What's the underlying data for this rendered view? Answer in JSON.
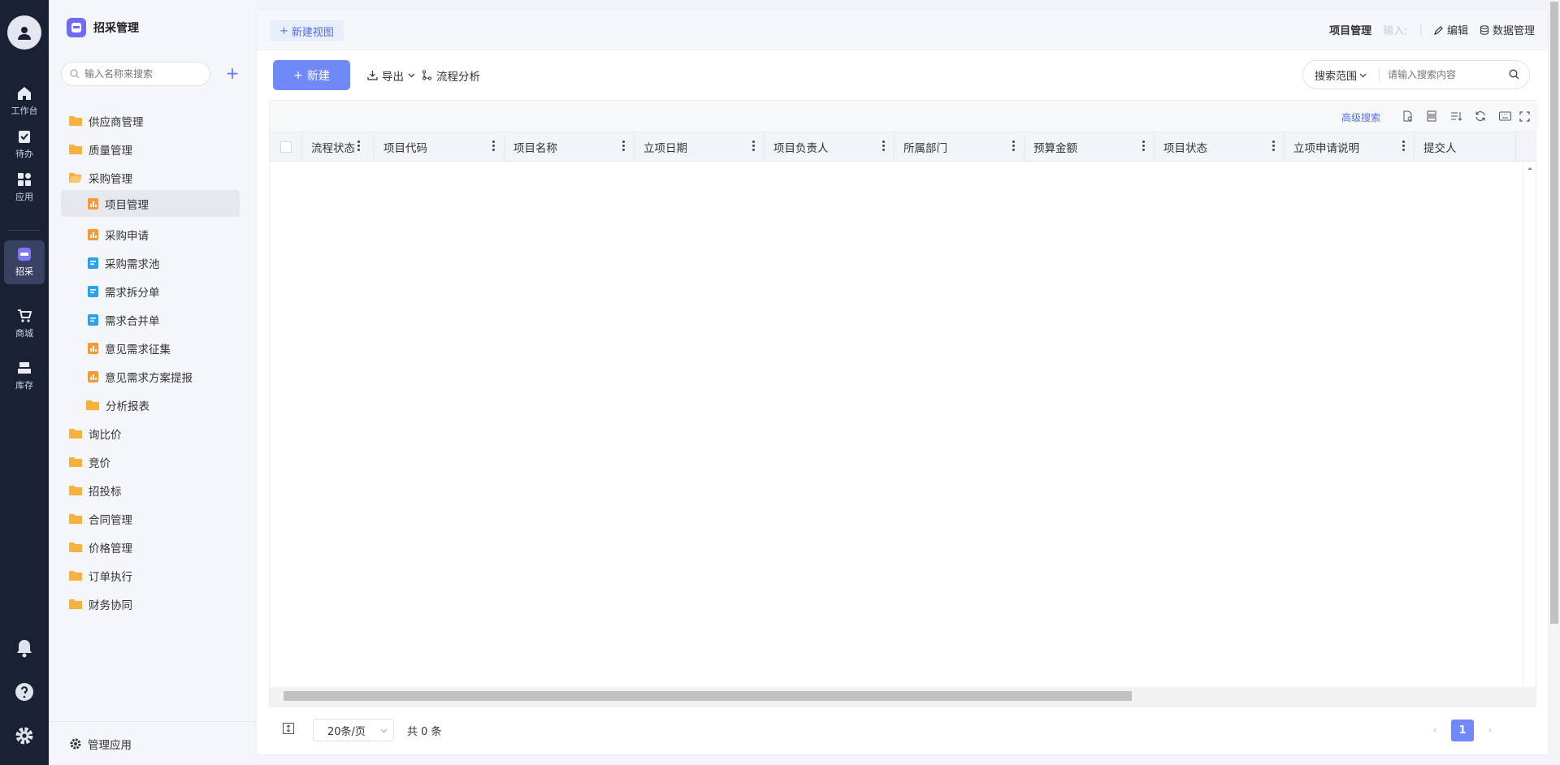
{
  "rail": {
    "items": [
      {
        "label": "工作台",
        "icon": "home-icon"
      },
      {
        "label": "待办",
        "icon": "todo-icon"
      },
      {
        "label": "应用",
        "icon": "apps-icon"
      },
      {
        "label": "招采",
        "icon": "procure-icon"
      },
      {
        "label": "商城",
        "icon": "cart-icon"
      },
      {
        "label": "库存",
        "icon": "inventory-icon"
      }
    ],
    "active": "招采"
  },
  "sidebar": {
    "app_title": "招采管理",
    "search_placeholder": "输入名称来搜索",
    "add_label": "+",
    "items": [
      {
        "label": "供应商管理",
        "type": "folder"
      },
      {
        "label": "质量管理",
        "type": "folder"
      },
      {
        "label": "采购管理",
        "type": "folder"
      },
      {
        "label": "项目管理",
        "type": "form-orange",
        "active": true
      },
      {
        "label": "采购申请",
        "type": "form-orange"
      },
      {
        "label": "采购需求池",
        "type": "form-blue"
      },
      {
        "label": "需求拆分单",
        "type": "form-blue"
      },
      {
        "label": "需求合并单",
        "type": "form-blue"
      },
      {
        "label": "意见需求征集",
        "type": "form-orange"
      },
      {
        "label": "意见需求方案提报",
        "type": "form-orange"
      },
      {
        "label": "分析报表",
        "type": "folder"
      },
      {
        "label": "询比价",
        "type": "folder"
      },
      {
        "label": "竞价",
        "type": "folder"
      },
      {
        "label": "招投标",
        "type": "folder"
      },
      {
        "label": "合同管理",
        "type": "folder"
      },
      {
        "label": "价格管理",
        "type": "folder"
      },
      {
        "label": "订单执行",
        "type": "folder"
      },
      {
        "label": "财务协同",
        "type": "folder"
      }
    ],
    "footer_label": "管理应用"
  },
  "topbar": {
    "new_view": "新建视图",
    "page_title": "项目管理",
    "input_hint": "输入:",
    "separator": "|",
    "edit": "编辑",
    "data_manage": "数据管理"
  },
  "toolbar": {
    "new_label": "新建",
    "export_label": "导出",
    "flow_label": "流程分析",
    "scope_label": "搜索范围",
    "search_placeholder": "请输入搜索内容"
  },
  "grid": {
    "advanced_search": "高级搜索",
    "columns": [
      "流程状态",
      "项目代码",
      "项目名称",
      "立项日期",
      "项目负责人",
      "所属部门",
      "预算金额",
      "项目状态",
      "立项申请说明",
      "提交人"
    ],
    "rows": []
  },
  "pager": {
    "page_size": "20条/页",
    "total": "共 0 条",
    "current_page": "1"
  },
  "colors": {
    "accent": "#6f89f8",
    "link": "#5470e6",
    "rail_bg": "#1b2135",
    "folder": "#f6b23c",
    "form_orange": "#f39b3a",
    "form_blue": "#2d9ff0"
  }
}
